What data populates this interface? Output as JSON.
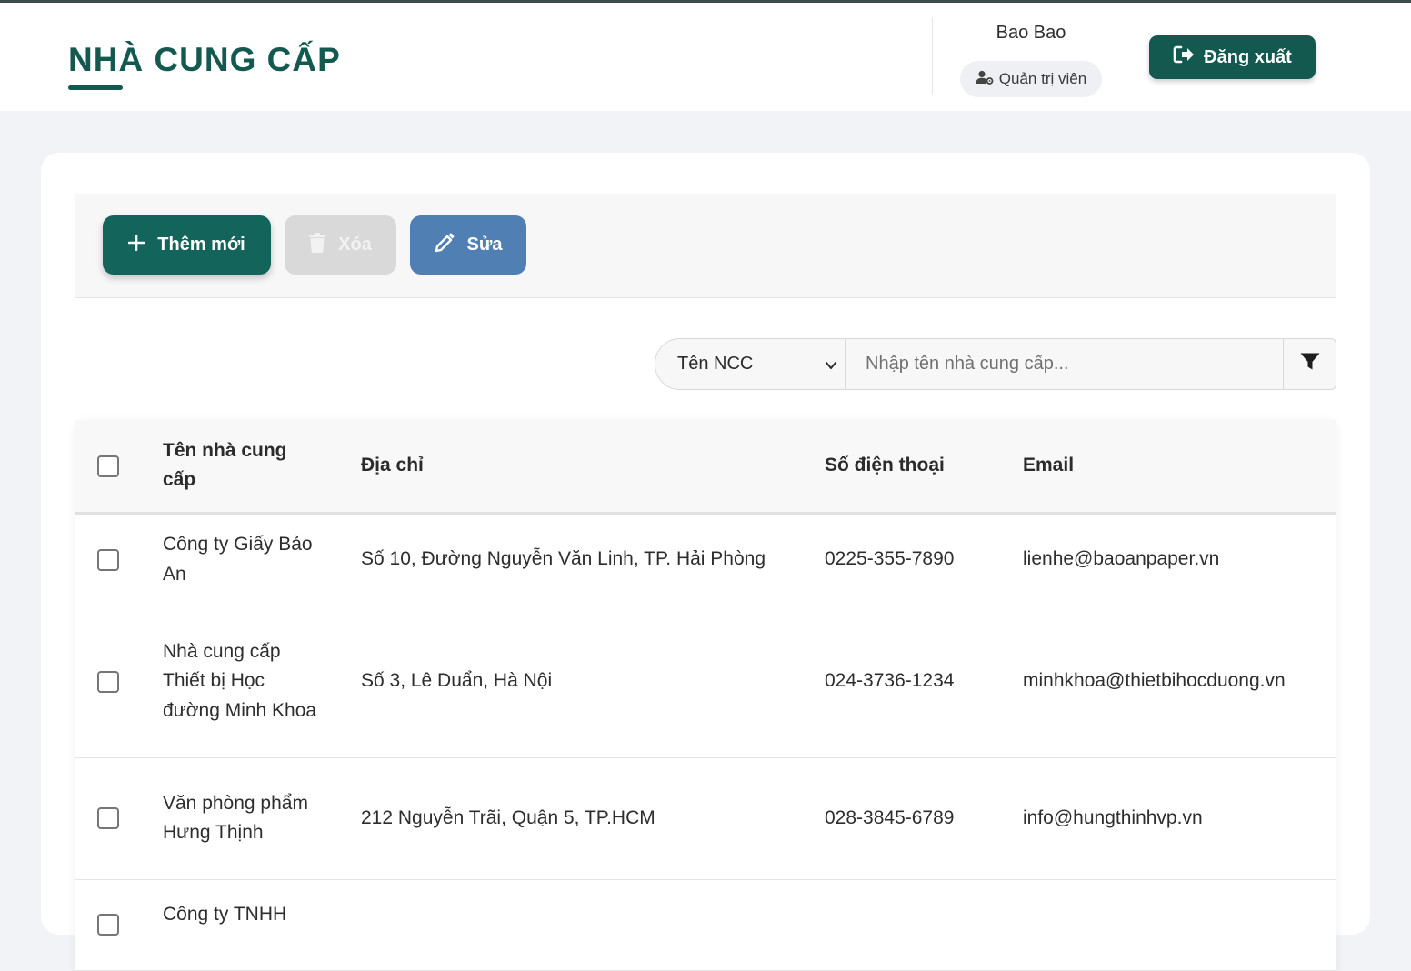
{
  "header": {
    "title": "NHÀ CUNG CẤP",
    "user_name": "Bao Bao",
    "role": "Quản trị viên",
    "logout_label": "Đăng xuất"
  },
  "toolbar": {
    "add_label": "Thêm mới",
    "delete_label": "Xóa",
    "edit_label": "Sửa"
  },
  "search": {
    "field_selected": "Tên NCC",
    "placeholder": "Nhập tên nhà cung cấp..."
  },
  "table": {
    "columns": [
      "Tên nhà cung cấp",
      "Địa chỉ",
      "Số điện thoại",
      "Email"
    ],
    "rows": [
      {
        "name": "Công ty Giấy Bảo An",
        "address": "Số 10, Đường Nguyễn Văn Linh, TP. Hải Phòng",
        "phone": "0225-355-7890",
        "email": "lienhe@baoanpaper.vn"
      },
      {
        "name": "Nhà cung cấp Thiết bị Học đường Minh Khoa",
        "address": "Số 3, Lê Duẩn, Hà Nội",
        "phone": "024-3736-1234",
        "email": "minhkhoa@thietbihocduong.vn"
      },
      {
        "name": "Văn phòng phẩm Hưng Thịnh",
        "address": "212 Nguyễn Trãi, Quận 5, TP.HCM",
        "phone": "028-3845-6789",
        "email": "info@hungthinhvp.vn"
      },
      {
        "name": "Công ty TNHH",
        "address": "",
        "phone": "",
        "email": ""
      }
    ]
  },
  "colors": {
    "primary": "#13594f",
    "add_button": "#13645a",
    "edit_button": "#507fb4",
    "delete_button_disabled": "#d9d9d9"
  },
  "icons": {
    "role": "user-gear-icon",
    "logout": "sign-out-icon",
    "add": "plus-icon",
    "delete": "trash-icon",
    "edit": "pencil-icon",
    "select": "chevron-down-icon",
    "filter": "filter-icon"
  }
}
